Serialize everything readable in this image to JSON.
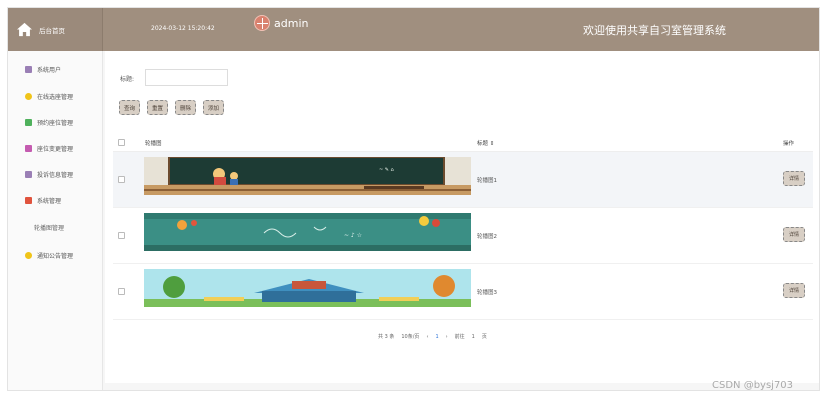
{
  "header": {
    "brand": "后台首页",
    "home_icon": "home-icon",
    "datetime": "2024-03-12 15:20:42",
    "username": "admin",
    "system_title": "欢迎使用共享自习室管理系统"
  },
  "sidebar": {
    "items": [
      {
        "label": "系统用户",
        "icon": "user-icon",
        "color": "#9a7fb5"
      },
      {
        "label": "在线选座管理",
        "icon": "circle-icon",
        "color": "#f0c419"
      },
      {
        "label": "预约座位管理",
        "icon": "chat-icon",
        "color": "#4fb15c"
      },
      {
        "label": "座位变更管理",
        "icon": "doc-icon",
        "color": "#c45bb0"
      },
      {
        "label": "投诉信息管理",
        "icon": "user-icon",
        "color": "#9a7fb5"
      },
      {
        "label": "系统管理",
        "icon": "grid-icon",
        "color": "#e0533d"
      },
      {
        "label": "通知公告管理",
        "icon": "circle-icon",
        "color": "#f0c419"
      }
    ],
    "sub_item": "轮播图管理"
  },
  "main": {
    "search_label": "标题:",
    "search_value": "",
    "buttons": [
      "查询",
      "重置",
      "删除",
      "添加"
    ],
    "columns": [
      "轮播图",
      "标题 ⇕",
      "操作"
    ],
    "rows": [
      {
        "title": "轮播图1",
        "op": "详情"
      },
      {
        "title": "轮播图2",
        "op": "详情"
      },
      {
        "title": "轮播图3",
        "op": "详情"
      }
    ],
    "pager": {
      "total": "共 3 条",
      "per_page": "10条/页",
      "prev": "‹",
      "current": "1",
      "next": "›",
      "goto_prefix": "前往",
      "goto_value": "1",
      "goto_suffix": "页"
    }
  },
  "watermark": "CSDN @bysj703"
}
